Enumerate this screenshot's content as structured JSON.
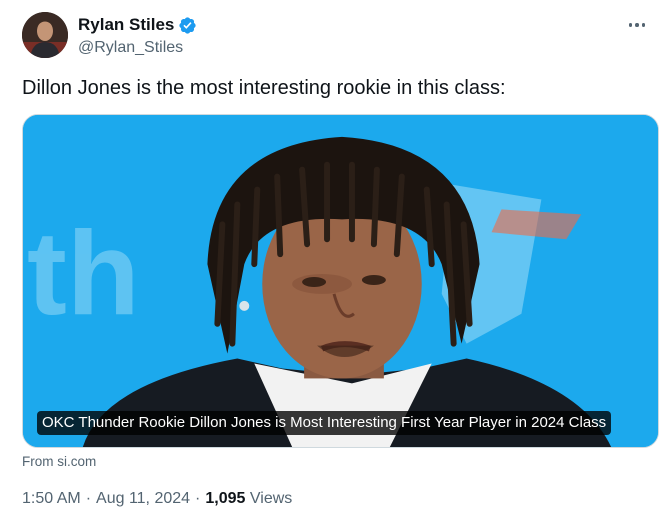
{
  "author": {
    "name": "Rylan Stiles",
    "handle": "@Rylan_Stiles",
    "verified_icon": "verified-badge-icon",
    "verified_color": "#1d9bf0"
  },
  "tweet": {
    "text": "Dillon Jones is the most interesting rookie in this class:"
  },
  "card": {
    "title": "OKC Thunder Rookie Dillon Jones is Most Interesting First Year Player in 2024 Class",
    "source": "From si.com",
    "background_color": "#1aa7ec"
  },
  "meta": {
    "time": "1:50 AM",
    "separator": "·",
    "date": "Aug 11, 2024",
    "views_count": "1,095",
    "views_label": "Views"
  },
  "colors": {
    "text_primary": "#0f1419",
    "text_secondary": "#536471",
    "border": "#cfd9de"
  }
}
